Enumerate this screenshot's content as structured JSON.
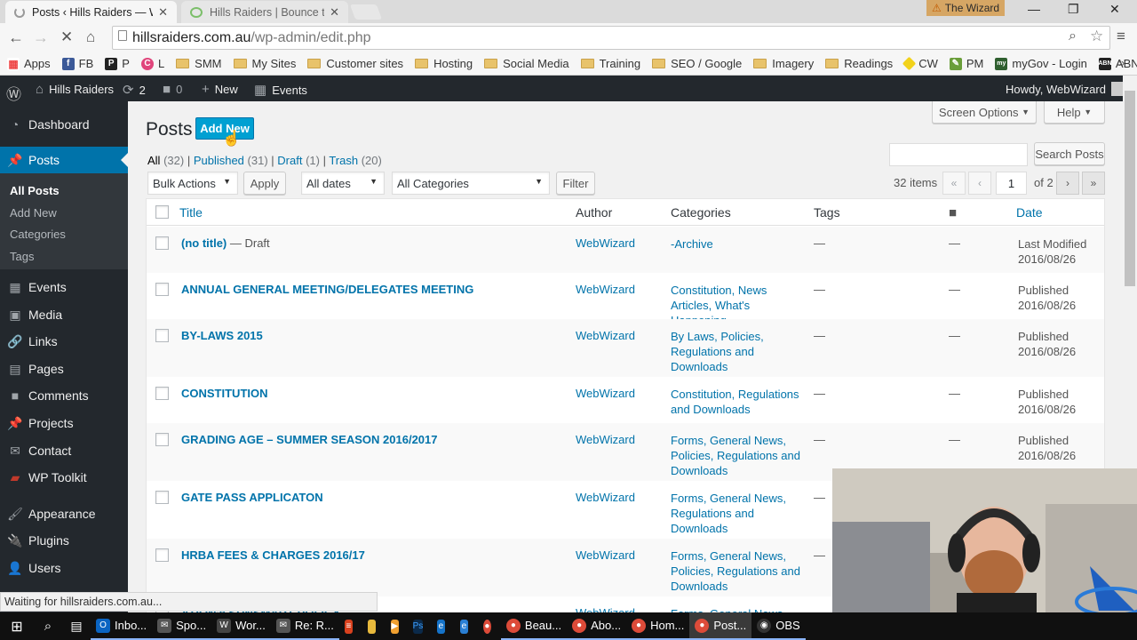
{
  "browser": {
    "tabs": [
      {
        "title": "Posts ‹ Hills Raiders — Wo",
        "active": true
      },
      {
        "title": "Hills Raiders | Bounce tha",
        "active": false
      }
    ],
    "profile_name": "The Wizard",
    "url_domain": "hillsraiders.com.au",
    "url_path": "/wp-admin/edit.php",
    "status_text": "Waiting for hillsraiders.com.au..."
  },
  "bookmarks": [
    {
      "label": "Apps",
      "icon": "apps-grid-icon"
    },
    {
      "label": "FB",
      "icon": "facebook-icon"
    },
    {
      "label": "P",
      "icon": "p-icon"
    },
    {
      "label": "L",
      "icon": "l-icon"
    },
    {
      "label": "SMM",
      "icon": "folder-icon"
    },
    {
      "label": "My Sites",
      "icon": "folder-icon"
    },
    {
      "label": "Customer sites",
      "icon": "folder-icon"
    },
    {
      "label": "Hosting",
      "icon": "folder-icon"
    },
    {
      "label": "Social Media",
      "icon": "folder-icon"
    },
    {
      "label": "Training",
      "icon": "folder-icon"
    },
    {
      "label": "SEO / Google",
      "icon": "folder-icon"
    },
    {
      "label": "Imagery",
      "icon": "folder-icon"
    },
    {
      "label": "Readings",
      "icon": "folder-icon"
    },
    {
      "label": "CW",
      "icon": "cw-icon"
    },
    {
      "label": "PM",
      "icon": "pm-icon"
    },
    {
      "label": "myGov - Login",
      "icon": "mygov-icon"
    },
    {
      "label": "ABN",
      "icon": "abn-icon"
    }
  ],
  "adminbar": {
    "site": "Hills Raiders",
    "updates": "2",
    "comments": "0",
    "new": "New",
    "events": "Events",
    "howdy": "Howdy, WebWizard"
  },
  "menu": [
    {
      "label": "Dashboard",
      "icon": "dashboard-icon"
    },
    {
      "label": "Posts",
      "icon": "pin-icon"
    },
    {
      "label": "Events",
      "icon": "calendar-icon"
    },
    {
      "label": "Media",
      "icon": "media-icon"
    },
    {
      "label": "Links",
      "icon": "link-icon"
    },
    {
      "label": "Pages",
      "icon": "pages-icon"
    },
    {
      "label": "Comments",
      "icon": "comment-icon"
    },
    {
      "label": "Projects",
      "icon": "pin-icon"
    },
    {
      "label": "Contact",
      "icon": "mail-icon"
    },
    {
      "label": "WP Toolkit",
      "icon": "toolkit-icon"
    },
    {
      "label": "Appearance",
      "icon": "brush-icon"
    },
    {
      "label": "Plugins",
      "icon": "plug-icon"
    },
    {
      "label": "Users",
      "icon": "users-icon"
    }
  ],
  "submenu": [
    "All Posts",
    "Add New",
    "Categories",
    "Tags"
  ],
  "page": {
    "title": "Posts",
    "add_new": "Add New",
    "screen_options": "Screen Options",
    "help": "Help",
    "search_button": "Search Posts",
    "search_value": ""
  },
  "filters": {
    "all": "All",
    "all_count": "(32)",
    "published": "Published",
    "published_count": "(31)",
    "draft": "Draft",
    "draft_count": "(1)",
    "trash": "Trash",
    "trash_count": "(20)",
    "bulk": "Bulk Actions",
    "apply": "Apply",
    "dates": "All dates",
    "categories": "All Categories",
    "filter": "Filter"
  },
  "pagination": {
    "items": "32 items",
    "current": "1",
    "of": "of 2",
    "first": "«",
    "prev": "‹",
    "next": "›",
    "last": "»"
  },
  "table": {
    "headers": {
      "title": "Title",
      "author": "Author",
      "categories": "Categories",
      "tags": "Tags",
      "date": "Date"
    },
    "rows": [
      {
        "title": "(no title)",
        "state": " — Draft",
        "author": "WebWizard",
        "categories": "-Archive",
        "tags": "—",
        "comments": "—",
        "date_status": "Last Modified",
        "date": "2016/08/26"
      },
      {
        "title": "ANNUAL GENERAL MEETING/DELEGATES MEETING",
        "state": "",
        "author": "WebWizard",
        "categories": "Constitution, News Articles, What's Happening",
        "tags": "—",
        "comments": "—",
        "date_status": "Published",
        "date": "2016/08/26"
      },
      {
        "title": "BY-LAWS 2015",
        "state": "",
        "author": "WebWizard",
        "categories": "By Laws, Policies, Regulations and Downloads",
        "tags": "—",
        "comments": "—",
        "date_status": "Published",
        "date": "2016/08/26"
      },
      {
        "title": "CONSTITUTION",
        "state": "",
        "author": "WebWizard",
        "categories": "Constitution, Regulations and Downloads",
        "tags": "—",
        "comments": "—",
        "date_status": "Published",
        "date": "2016/08/26"
      },
      {
        "title": "GRADING AGE – SUMMER SEASON 2016/2017",
        "state": "",
        "author": "WebWizard",
        "categories": "Forms, General News, Policies, Regulations and Downloads",
        "tags": "—",
        "comments": "—",
        "date_status": "Published",
        "date": "2016/08/26"
      },
      {
        "title": "GATE PASS APPLICATON",
        "state": "",
        "author": "WebWizard",
        "categories": "Forms, General News, Regulations and Downloads",
        "tags": "—",
        "comments": "",
        "date_status": "",
        "date": ""
      },
      {
        "title": "HRBA FEES & CHARGES 2016/17",
        "state": "",
        "author": "WebWizard",
        "categories": "Forms, General News, Policies, Regulations and Downloads",
        "tags": "—",
        "comments": "",
        "date_status": "",
        "date": ""
      },
      {
        "title": "ATION's SUNSMART POLICY",
        "state": "",
        "author": "WebWizard",
        "categories": "Forms, General News",
        "tags": "—",
        "comments": "",
        "date_status": "",
        "date": ""
      }
    ]
  },
  "taskbar": [
    {
      "label": "Inbo...",
      "icon": "outlook-icon"
    },
    {
      "label": "Spo...",
      "icon": "mail-icon"
    },
    {
      "label": "Wor...",
      "icon": "word-icon"
    },
    {
      "label": "Re: R...",
      "icon": "mail-icon"
    },
    {
      "label": "Beau...",
      "icon": "chrome-icon"
    },
    {
      "label": "Abo...",
      "icon": "chrome-icon"
    },
    {
      "label": "Hom...",
      "icon": "chrome-icon"
    },
    {
      "label": "Post...",
      "icon": "chrome-icon"
    },
    {
      "label": "OBS",
      "icon": "obs-icon"
    }
  ]
}
